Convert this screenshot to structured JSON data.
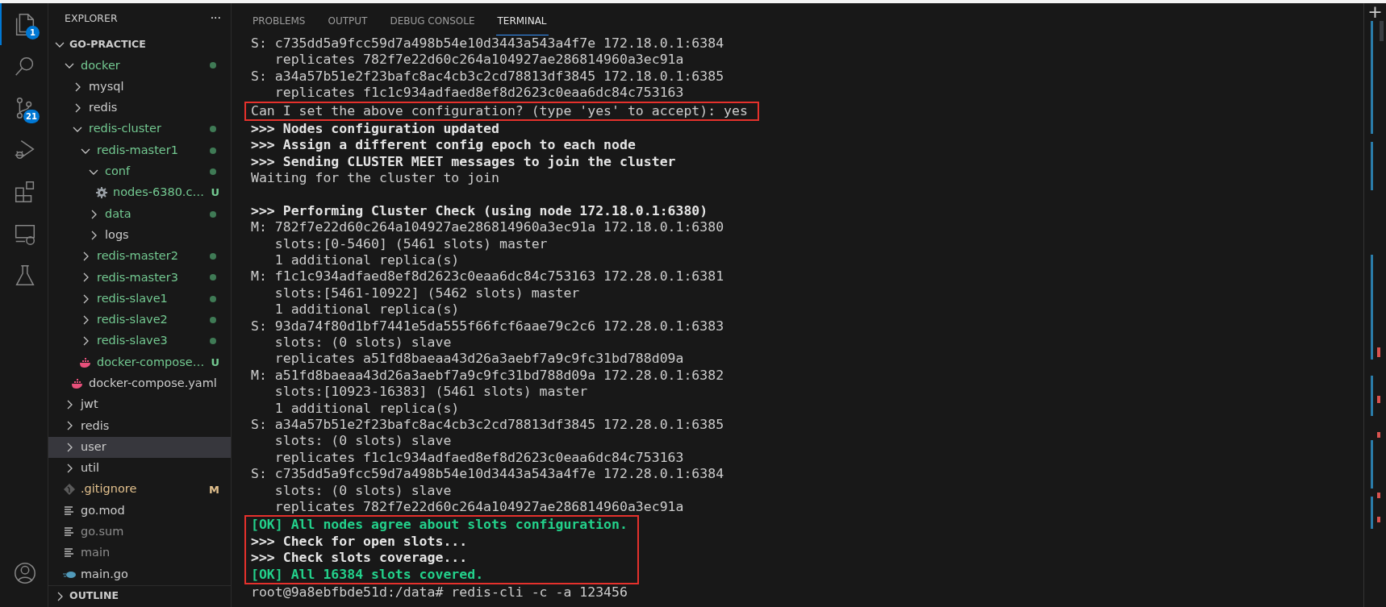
{
  "activity_bar": [
    {
      "kind": "files",
      "badge": "1",
      "selected": true
    },
    {
      "kind": "search",
      "selected": false
    },
    {
      "kind": "source-control",
      "badge": "21",
      "selected": false
    },
    {
      "kind": "run-debug",
      "selected": false
    },
    {
      "kind": "extensions",
      "selected": false
    },
    {
      "kind": "remote",
      "selected": false
    },
    {
      "kind": "testing",
      "selected": false
    }
  ],
  "account": {
    "kind": "account"
  },
  "explorer": {
    "title": "EXPLORER",
    "more": "···",
    "workspace": {
      "name": "GO-PRACTICE",
      "expanded": true,
      "children": [
        {
          "label": "docker",
          "kind": "folder",
          "expanded": true,
          "color": "#73c991",
          "dot": true,
          "selected": false,
          "children": [
            {
              "label": "mysql",
              "kind": "folder",
              "expanded": false,
              "color": "#cccccc",
              "dot": false,
              "selected": false
            },
            {
              "label": "redis",
              "kind": "folder",
              "expanded": false,
              "color": "#cccccc",
              "dot": false,
              "selected": false
            },
            {
              "label": "redis-cluster",
              "kind": "folder",
              "expanded": true,
              "color": "#73c991",
              "dot": true,
              "selected": false,
              "children": [
                {
                  "label": "redis-master1",
                  "kind": "folder",
                  "expanded": true,
                  "color": "#73c991",
                  "dot": true,
                  "selected": false,
                  "children": [
                    {
                      "label": "conf",
                      "kind": "folder",
                      "expanded": true,
                      "color": "#73c991",
                      "dot": true,
                      "selected": false,
                      "children": [
                        {
                          "label": "nodes-6380.c…",
                          "kind": "gear",
                          "color": "#73c991",
                          "badge": "U",
                          "dot": false,
                          "selected": false
                        }
                      ]
                    },
                    {
                      "label": "data",
                      "kind": "folder",
                      "expanded": false,
                      "color": "#73c991",
                      "dot": true,
                      "selected": false
                    },
                    {
                      "label": "logs",
                      "kind": "folder",
                      "expanded": false,
                      "color": "#cccccc",
                      "dot": false,
                      "selected": false
                    }
                  ]
                },
                {
                  "label": "redis-master2",
                  "kind": "folder",
                  "expanded": false,
                  "color": "#73c991",
                  "dot": true,
                  "selected": false
                },
                {
                  "label": "redis-master3",
                  "kind": "folder",
                  "expanded": false,
                  "color": "#73c991",
                  "dot": true,
                  "selected": false
                },
                {
                  "label": "redis-slave1",
                  "kind": "folder",
                  "expanded": false,
                  "color": "#73c991",
                  "dot": true,
                  "selected": false
                },
                {
                  "label": "redis-slave2",
                  "kind": "folder",
                  "expanded": false,
                  "color": "#73c991",
                  "dot": true,
                  "selected": false
                },
                {
                  "label": "redis-slave3",
                  "kind": "folder",
                  "expanded": false,
                  "color": "#73c991",
                  "dot": true,
                  "selected": false
                },
                {
                  "label": "docker-compose…",
                  "kind": "docker",
                  "color": "#73c991",
                  "badge": "U",
                  "dot": false,
                  "selected": false
                }
              ]
            },
            {
              "label": "docker-compose.yaml",
              "kind": "docker",
              "color": "#cccccc",
              "dot": false,
              "selected": false
            }
          ]
        },
        {
          "label": "jwt",
          "kind": "folder",
          "expanded": false,
          "color": "#cccccc",
          "dot": false,
          "selected": false
        },
        {
          "label": "redis",
          "kind": "folder",
          "expanded": false,
          "color": "#cccccc",
          "dot": false,
          "selected": false
        },
        {
          "label": "user",
          "kind": "folder",
          "expanded": false,
          "color": "#cccccc",
          "dot": false,
          "selected": true
        },
        {
          "label": "util",
          "kind": "folder",
          "expanded": false,
          "color": "#cccccc",
          "dot": false,
          "selected": false
        },
        {
          "label": ".gitignore",
          "kind": "git",
          "color": "#e2c08d",
          "badge": "M",
          "dot": false,
          "selected": false
        },
        {
          "label": "go.mod",
          "kind": "text",
          "color": "#cccccc",
          "dot": false,
          "selected": false
        },
        {
          "label": "go.sum",
          "kind": "text",
          "color": "#8c8c8c",
          "dot": false,
          "selected": false
        },
        {
          "label": "main",
          "kind": "text",
          "color": "#8c8c8c",
          "dot": false,
          "selected": false
        },
        {
          "label": "main.go",
          "kind": "go",
          "color": "#cccccc",
          "dot": false,
          "selected": false
        }
      ]
    },
    "outline": {
      "title": "OUTLINE",
      "expanded": false
    }
  },
  "panel": {
    "tabs": [
      {
        "label": "PROBLEMS",
        "selected": false
      },
      {
        "label": "OUTPUT",
        "selected": false
      },
      {
        "label": "DEBUG CONSOLE",
        "selected": false
      },
      {
        "label": "TERMINAL",
        "selected": true
      }
    ],
    "new_terminal": "+",
    "terminal": [
      {
        "text": "S: c735dd5a9fcc59d7a498b54e10d3443a543a4f7e 172.18.0.1:6384",
        "kind": "plain",
        "boxed": false
      },
      {
        "text": "   replicates 782f7e22d60c264a104927ae286814960a3ec91a",
        "kind": "plain",
        "boxed": false
      },
      {
        "text": "S: a34a57b51e2f23bafc8ac4cb3c2cd78813df3845 172.18.0.1:6385",
        "kind": "plain",
        "boxed": false
      },
      {
        "text": "   replicates f1c1c934adfaed8ef8d2623c0eaa6dc84c753163",
        "kind": "plain",
        "boxed": false
      },
      {
        "text": "Can I set the above configuration? (type 'yes' to accept): yes",
        "kind": "plain",
        "boxed": true
      },
      {
        "text": ">>> Nodes configuration updated",
        "kind": "bold",
        "boxed": false
      },
      {
        "text": ">>> Assign a different config epoch to each node",
        "kind": "bold",
        "boxed": false
      },
      {
        "text": ">>> Sending CLUSTER MEET messages to join the cluster",
        "kind": "bold",
        "boxed": false
      },
      {
        "text": "Waiting for the cluster to join",
        "kind": "plain",
        "boxed": false
      },
      {
        "text": ">>> Performing Cluster Check (using node 172.18.0.1:6380)",
        "kind": "section",
        "boxed": false
      },
      {
        "text": "M: 782f7e22d60c264a104927ae286814960a3ec91a 172.18.0.1:6380",
        "kind": "plain",
        "boxed": false
      },
      {
        "text": "   slots:[0-5460] (5461 slots) master",
        "kind": "plain",
        "boxed": false
      },
      {
        "text": "   1 additional replica(s)",
        "kind": "plain",
        "boxed": false
      },
      {
        "text": "M: f1c1c934adfaed8ef8d2623c0eaa6dc84c753163 172.28.0.1:6381",
        "kind": "plain",
        "boxed": false
      },
      {
        "text": "   slots:[5461-10922] (5462 slots) master",
        "kind": "plain",
        "boxed": false
      },
      {
        "text": "   1 additional replica(s)",
        "kind": "plain",
        "boxed": false
      },
      {
        "text": "S: 93da74f80d1bf7441e5da555f66fcf6aae79c2c6 172.28.0.1:6383",
        "kind": "plain",
        "boxed": false
      },
      {
        "text": "   slots: (0 slots) slave",
        "kind": "plain",
        "boxed": false
      },
      {
        "text": "   replicates a51fd8baeaa43d26a3aebf7a9c9fc31bd788d09a",
        "kind": "plain",
        "boxed": false
      },
      {
        "text": "M: a51fd8baeaa43d26a3aebf7a9c9fc31bd788d09a 172.28.0.1:6382",
        "kind": "plain",
        "boxed": false
      },
      {
        "text": "   slots:[10923-16383] (5461 slots) master",
        "kind": "plain",
        "boxed": false
      },
      {
        "text": "   1 additional replica(s)",
        "kind": "plain",
        "boxed": false
      },
      {
        "text": "S: a34a57b51e2f23bafc8ac4cb3c2cd78813df3845 172.28.0.1:6385",
        "kind": "plain",
        "boxed": false
      },
      {
        "text": "   slots: (0 slots) slave",
        "kind": "plain",
        "boxed": false
      },
      {
        "text": "   replicates f1c1c934adfaed8ef8d2623c0eaa6dc84c753163",
        "kind": "plain",
        "boxed": false
      },
      {
        "text": "S: c735dd5a9fcc59d7a498b54e10d3443a543a4f7e 172.28.0.1:6384",
        "kind": "plain",
        "boxed": false
      },
      {
        "text": "   slots: (0 slots) slave",
        "kind": "plain",
        "boxed": false
      },
      {
        "text": "   replicates 782f7e22d60c264a104927ae286814960a3ec91a",
        "kind": "plain",
        "boxed": false
      },
      {
        "text": "[OK] All nodes agree about slots configuration.",
        "kind": "ok",
        "boxed": true
      },
      {
        "text": ">>> Check for open slots...",
        "kind": "bold",
        "boxed": true
      },
      {
        "text": ">>> Check slots coverage...",
        "kind": "bold",
        "boxed": true
      },
      {
        "text": "[OK] All 16384 slots covered.",
        "kind": "ok",
        "boxed": true
      },
      {
        "text": "root@9a8ebfbde51d:/data# redis-cli -c -a 123456",
        "kind": "plain",
        "boxed": false
      }
    ]
  }
}
